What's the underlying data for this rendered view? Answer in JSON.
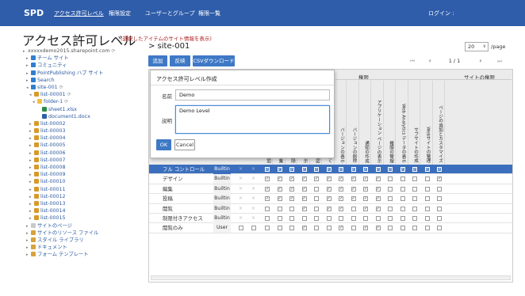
{
  "nav": {
    "brand": "SPD",
    "items": [
      "アクセス許可レベル",
      "権限設定",
      "ユーザーとグループ",
      "権限一覧"
    ],
    "login": "ログイン :"
  },
  "page": {
    "title": "アクセス許可レベル",
    "subtitle": "(選択したアイテムのサイト情報を表示)"
  },
  "tree": [
    {
      "label": "xxxxxdemo2015.sharepoint.com",
      "icon": "",
      "refresh": true
    },
    {
      "label": "チーム サイト",
      "icon": "site"
    },
    {
      "label": "コミュニティ",
      "icon": "site"
    },
    {
      "label": "PointPublishing ハブ サイト",
      "icon": "site"
    },
    {
      "label": "Search",
      "icon": "site"
    },
    {
      "label": "site-001",
      "icon": "site",
      "refresh": true
    },
    {
      "label": "list-00001",
      "icon": "list",
      "refresh": true
    },
    {
      "label": "folder-1",
      "icon": "folder",
      "refresh": true
    },
    {
      "label": "sheet1.xlsx",
      "icon": "xlsx"
    },
    {
      "label": "document1.docx",
      "icon": "docx"
    },
    {
      "label": "list-00002",
      "icon": "list"
    },
    {
      "label": "list-00003",
      "icon": "list"
    },
    {
      "label": "list-00004",
      "icon": "list"
    },
    {
      "label": "list-00005",
      "icon": "list"
    },
    {
      "label": "list-00006",
      "icon": "list"
    },
    {
      "label": "list-00007",
      "icon": "list"
    },
    {
      "label": "list-00008",
      "icon": "list"
    },
    {
      "label": "list-00009",
      "icon": "list"
    },
    {
      "label": "list-00010",
      "icon": "list"
    },
    {
      "label": "list-00011",
      "icon": "list"
    },
    {
      "label": "list-00012",
      "icon": "list"
    },
    {
      "label": "list-00013",
      "icon": "list"
    },
    {
      "label": "list-00014",
      "icon": "list"
    },
    {
      "label": "list-00015",
      "icon": "list"
    },
    {
      "label": "サイトのページ",
      "icon": "page"
    },
    {
      "label": "サイトのリソース ファイル",
      "icon": "lib"
    },
    {
      "label": "スタイル ライブラリ",
      "icon": "lib"
    },
    {
      "label": "ドキュメント",
      "icon": "lib"
    },
    {
      "label": "フォーム テンプレート",
      "icon": "lib"
    }
  ],
  "main": {
    "breadcrumb": "> site-001",
    "page_size": "20",
    "per_page": "/page",
    "buttons": {
      "add": "追加",
      "reflect": "反映",
      "csv": "CSVダウンロード"
    },
    "pager": {
      "first": "⏮",
      "prev": "⏴",
      "page": "1 / 1",
      "next": "⏵",
      "last": "⏭"
    }
  },
  "grid": {
    "group_list": "権限",
    "group_site": "サイトの権限",
    "columns": [
      "アイテムの追加",
      "アイテムの編集",
      "アイテムの削除",
      "アイテムの表示",
      "アイテムの承認",
      "アイテムを開く",
      "バージョンの表示",
      "バージョンの削除",
      "通知の作成",
      "アプリケーション ページの表示",
      "権限の管理",
      "Web Analytics データの表示",
      "サブサイトの作成",
      "Webサイトの管理",
      "ページの追加とカスタマイズ"
    ],
    "rows": [
      {
        "name": "フル コントロール",
        "type": "Builtin",
        "selected": true,
        "checks": [
          1,
          1,
          1,
          1,
          1,
          1,
          1,
          1,
          1,
          1,
          1,
          1,
          1,
          1,
          1
        ]
      },
      {
        "name": "デザイン",
        "type": "Builtin",
        "checks": [
          1,
          1,
          1,
          1,
          1,
          1,
          1,
          1,
          1,
          1,
          0,
          0,
          0,
          0,
          1
        ]
      },
      {
        "name": "編集",
        "type": "Builtin",
        "checks": [
          1,
          1,
          1,
          1,
          0,
          1,
          1,
          1,
          1,
          1,
          0,
          0,
          0,
          0,
          0
        ]
      },
      {
        "name": "投稿",
        "type": "Builtin",
        "checks": [
          1,
          1,
          1,
          1,
          0,
          1,
          1,
          1,
          1,
          1,
          0,
          0,
          0,
          0,
          0
        ]
      },
      {
        "name": "閲覧",
        "type": "Builtin",
        "checks": [
          0,
          0,
          0,
          1,
          0,
          1,
          1,
          0,
          1,
          1,
          0,
          0,
          0,
          0,
          0
        ]
      },
      {
        "name": "制限付きアクセス",
        "type": "Builtin",
        "checks": [
          0,
          0,
          0,
          0,
          0,
          0,
          0,
          0,
          0,
          0,
          0,
          0,
          0,
          0,
          0
        ]
      },
      {
        "name": "閲覧のみ",
        "type": "User",
        "checks": [
          0,
          0,
          0,
          1,
          0,
          0,
          1,
          0,
          1,
          1,
          0,
          0,
          0,
          0,
          0
        ]
      }
    ]
  },
  "dialog": {
    "title": "アクセス許可レベル作成",
    "name_label": "名前",
    "name_value": "Demo",
    "desc_label": "説明",
    "desc_value": "Demo Level",
    "ok": "OK",
    "cancel": "Cancel"
  }
}
